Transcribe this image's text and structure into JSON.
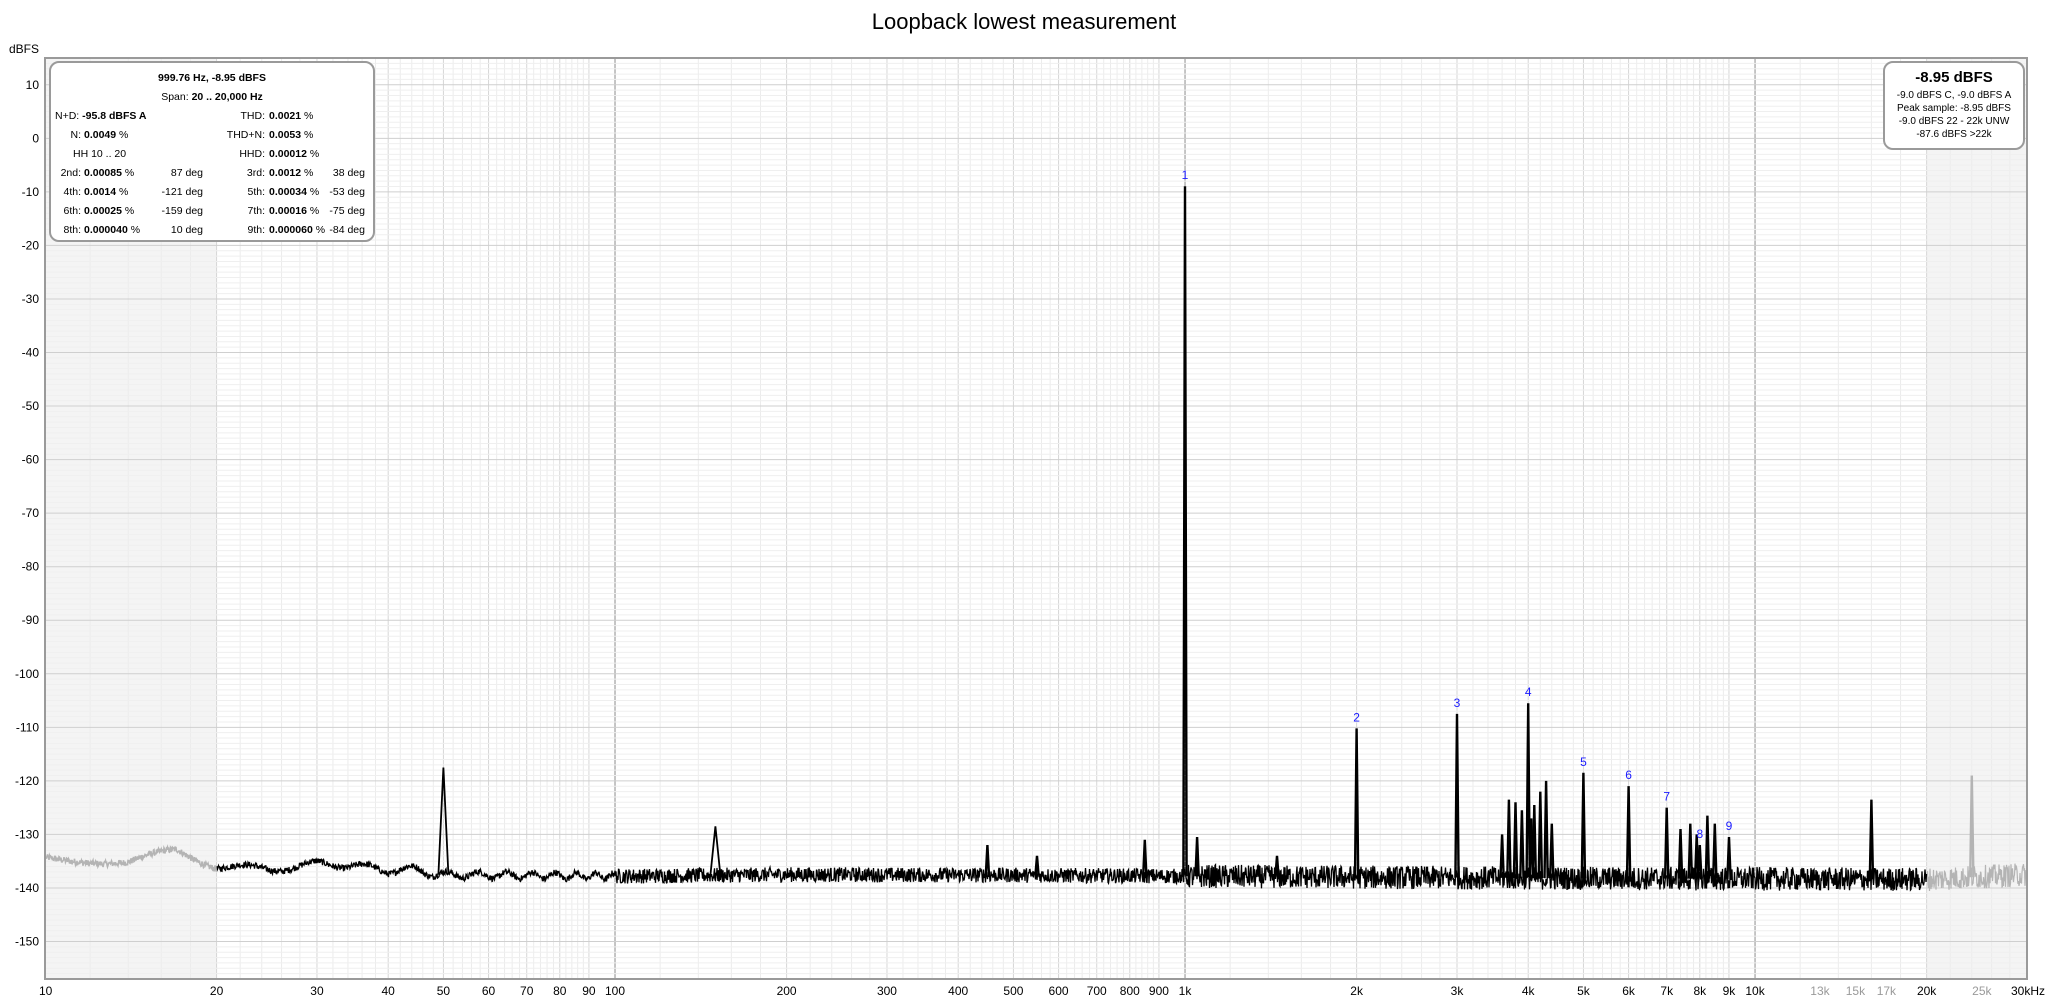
{
  "chart_data": {
    "type": "line",
    "title": "Loopback lowest measurement",
    "ylabel": "dBFS",
    "xlabel": "",
    "x_scale": "log",
    "xlim": [
      10,
      30000
    ],
    "ylim": [
      -157,
      15
    ],
    "y_ticks": [
      "10",
      "0",
      "-10",
      "-20",
      "-30",
      "-40",
      "-50",
      "-60",
      "-70",
      "-80",
      "-90",
      "-100",
      "-110",
      "-120",
      "-130",
      "-140",
      "-150"
    ],
    "x_ticks": [
      {
        "v": 10,
        "label": "10"
      },
      {
        "v": 20,
        "label": "20"
      },
      {
        "v": 30,
        "label": "30"
      },
      {
        "v": 40,
        "label": "40"
      },
      {
        "v": 50,
        "label": "50"
      },
      {
        "v": 60,
        "label": "60"
      },
      {
        "v": 70,
        "label": "70"
      },
      {
        "v": 80,
        "label": "80"
      },
      {
        "v": 90,
        "label": "90"
      },
      {
        "v": 100,
        "label": "100"
      },
      {
        "v": 200,
        "label": "200"
      },
      {
        "v": 300,
        "label": "300"
      },
      {
        "v": 400,
        "label": "400"
      },
      {
        "v": 500,
        "label": "500"
      },
      {
        "v": 600,
        "label": "600"
      },
      {
        "v": 700,
        "label": "700"
      },
      {
        "v": 800,
        "label": "800"
      },
      {
        "v": 900,
        "label": "900"
      },
      {
        "v": 1000,
        "label": "1k"
      },
      {
        "v": 2000,
        "label": "2k"
      },
      {
        "v": 3000,
        "label": "3k"
      },
      {
        "v": 4000,
        "label": "4k"
      },
      {
        "v": 5000,
        "label": "5k"
      },
      {
        "v": 6000,
        "label": "6k"
      },
      {
        "v": 7000,
        "label": "7k"
      },
      {
        "v": 8000,
        "label": "8k"
      },
      {
        "v": 9000,
        "label": "9k"
      },
      {
        "v": 10000,
        "label": "10k"
      },
      {
        "v": 13000,
        "label": "13k",
        "gray": true
      },
      {
        "v": 15000,
        "label": "15k",
        "gray": true
      },
      {
        "v": 17000,
        "label": "17k",
        "gray": true
      },
      {
        "v": 20000,
        "label": "20k"
      },
      {
        "v": 25000,
        "label": "25k",
        "gray": true
      },
      {
        "v": 30000,
        "label": "30kHz"
      }
    ],
    "analysis_band": [
      20,
      20000
    ],
    "noise_floor": [
      [
        10,
        -134.5
      ],
      [
        12,
        -134.8
      ],
      [
        14,
        -135.2
      ],
      [
        17,
        -133.0
      ],
      [
        20,
        -136.0
      ],
      [
        25,
        -136.5
      ],
      [
        30,
        -135.5
      ],
      [
        35,
        -135.8
      ],
      [
        40,
        -136.8
      ],
      [
        45,
        -136.4
      ],
      [
        48,
        -137.5
      ],
      [
        100,
        -137.8
      ],
      [
        200,
        -137.5
      ],
      [
        500,
        -137.6
      ],
      [
        1000,
        -137.8
      ],
      [
        2000,
        -138.0
      ],
      [
        5000,
        -138.2
      ],
      [
        10000,
        -138.3
      ],
      [
        20000,
        -138.4
      ],
      [
        30000,
        -137.5
      ]
    ],
    "spikes": [
      {
        "f": 50,
        "db": -117.5
      },
      {
        "f": 150,
        "db": -128.5
      },
      {
        "f": 450,
        "db": -132.0
      },
      {
        "f": 550,
        "db": -134.0
      },
      {
        "f": 850,
        "db": -131.0
      },
      {
        "f": 1000,
        "db": -8.95
      },
      {
        "f": 1050,
        "db": -130.5
      },
      {
        "f": 1450,
        "db": -134.0
      },
      {
        "f": 2000,
        "db": -110.2
      },
      {
        "f": 3000,
        "db": -107.5
      },
      {
        "f": 3600,
        "db": -130.0
      },
      {
        "f": 3700,
        "db": -123.5
      },
      {
        "f": 3800,
        "db": -124.0
      },
      {
        "f": 3900,
        "db": -125.5
      },
      {
        "f": 4000,
        "db": -105.5
      },
      {
        "f": 4050,
        "db": -127.0
      },
      {
        "f": 4100,
        "db": -124.5
      },
      {
        "f": 4200,
        "db": -122.0
      },
      {
        "f": 4300,
        "db": -120.0
      },
      {
        "f": 4400,
        "db": -128.0
      },
      {
        "f": 5000,
        "db": -118.5
      },
      {
        "f": 6000,
        "db": -121.0
      },
      {
        "f": 7000,
        "db": -125.0
      },
      {
        "f": 7400,
        "db": -129.0
      },
      {
        "f": 7700,
        "db": -128.0
      },
      {
        "f": 7900,
        "db": -130.0
      },
      {
        "f": 8000,
        "db": -132.0
      },
      {
        "f": 8250,
        "db": -126.5
      },
      {
        "f": 8500,
        "db": -128.0
      },
      {
        "f": 9000,
        "db": -130.5
      },
      {
        "f": 16000,
        "db": -123.5
      },
      {
        "f": 24000,
        "db": -119.0
      }
    ],
    "harmonic_markers": [
      {
        "label": "1",
        "f": 1000,
        "db": -8.95
      },
      {
        "label": "2",
        "f": 2000,
        "db": -110.2
      },
      {
        "label": "3",
        "f": 3000,
        "db": -107.5
      },
      {
        "label": "4",
        "f": 4000,
        "db": -105.5
      },
      {
        "label": "5",
        "f": 5000,
        "db": -118.5
      },
      {
        "label": "6",
        "f": 6000,
        "db": -121.0
      },
      {
        "label": "7",
        "f": 7000,
        "db": -125.0
      },
      {
        "label": "8",
        "f": 8000,
        "db": -132.0
      },
      {
        "label": "9",
        "f": 9000,
        "db": -130.5
      }
    ]
  },
  "stats_box": {
    "fundamental": "999.76 Hz, -8.95 dBFS",
    "span_label": "Span:",
    "span_value": "20 .. 20,000 Hz",
    "nd_label": "N+D:",
    "nd_value": "-95.8 dBFS A",
    "thd_label": "THD:",
    "thd_value": "0.0021",
    "n_label": "N:",
    "n_value": "0.0049",
    "thdn_label": "THD+N:",
    "thdn_value": "0.0053",
    "hh_label": "HH 10 .. 20",
    "hhd_label": "HHD:",
    "hhd_value": "0.00012",
    "pct": "%",
    "harmonics": [
      {
        "label": "2nd:",
        "value": "0.00085",
        "phase": "87 deg"
      },
      {
        "label": "3rd:",
        "value": "0.0012",
        "phase": "38 deg"
      },
      {
        "label": "4th:",
        "value": "0.0014",
        "phase": "-121 deg"
      },
      {
        "label": "5th:",
        "value": "0.00034",
        "phase": "-53 deg"
      },
      {
        "label": "6th:",
        "value": "0.00025",
        "phase": "-159 deg"
      },
      {
        "label": "7th:",
        "value": "0.00016",
        "phase": "-75 deg"
      },
      {
        "label": "8th:",
        "value": "0.000040",
        "phase": "10 deg"
      },
      {
        "label": "9th:",
        "value": "0.000060",
        "phase": "-84 deg"
      }
    ]
  },
  "peak_box": {
    "main": "-8.95 dBFS",
    "line1": "-9.0 dBFS C, -9.0 dBFS A",
    "line2": "Peak sample: -8.95 dBFS",
    "line3": "-9.0 dBFS 22 - 22k UNW",
    "line4": "-87.6 dBFS >22k"
  },
  "colors": {
    "trace": "#000000",
    "trace_outside_band": "#b4b4b4",
    "grid_major": "#8c8c8c",
    "grid_minor": "#d6d6d6",
    "outside_band_fill": "#f4f4f4",
    "harmonic_label": "#1a1aff"
  }
}
